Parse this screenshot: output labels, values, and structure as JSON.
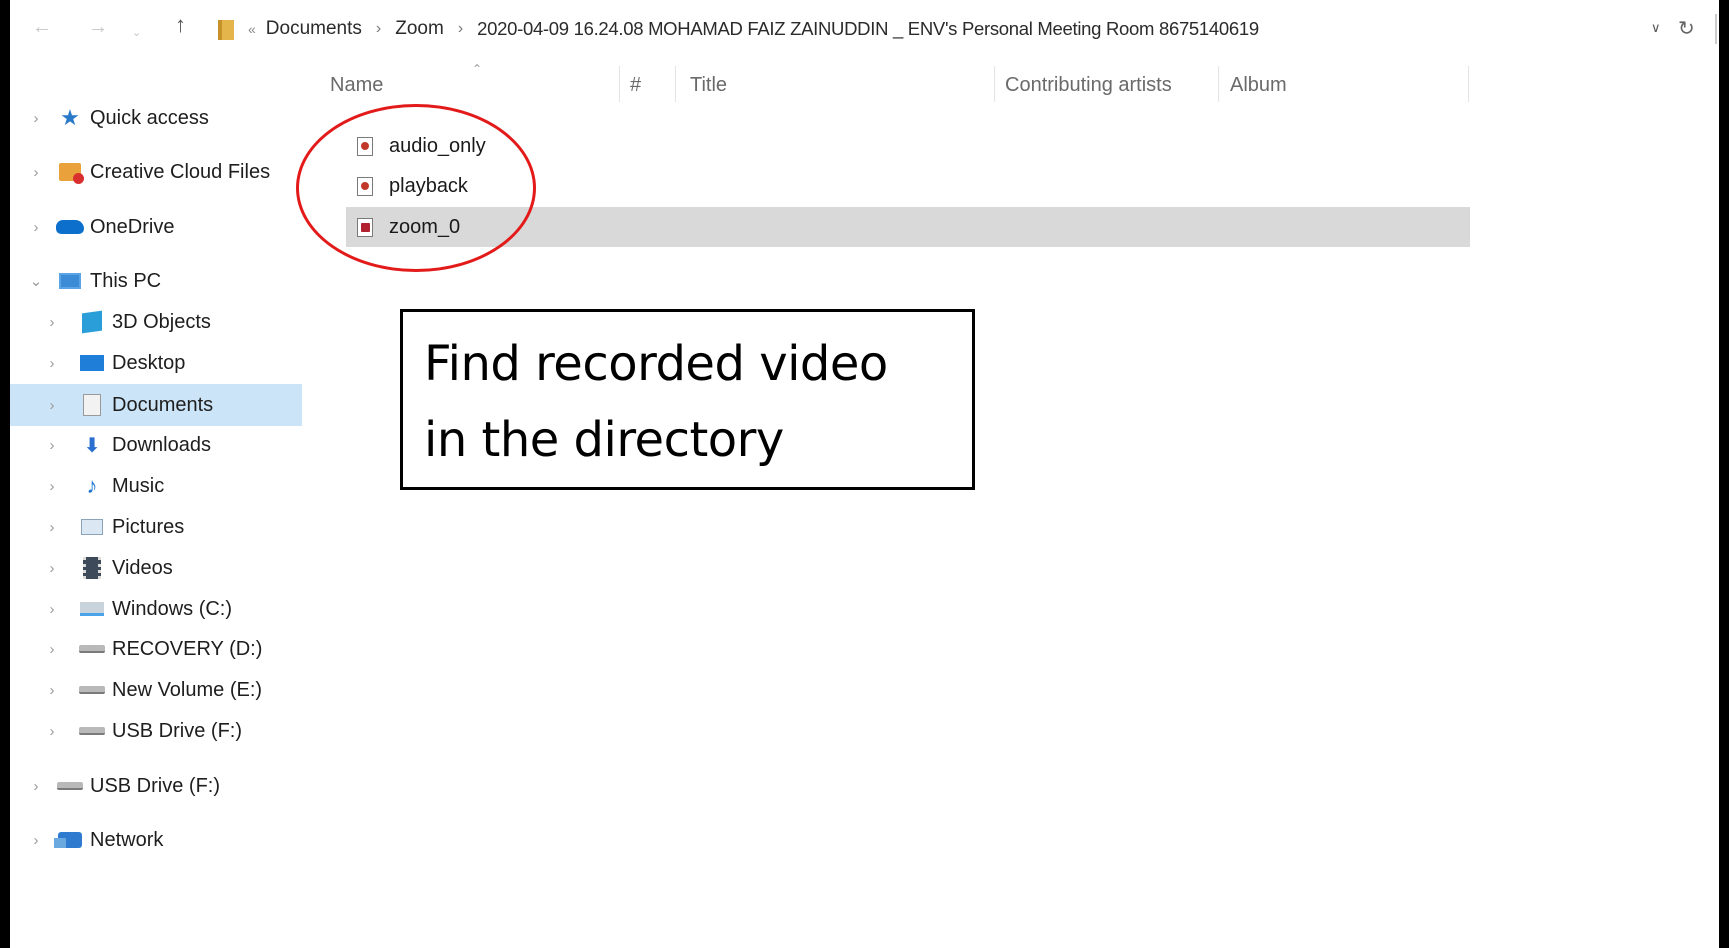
{
  "address_bar": {
    "back_icon": "arrow-left-icon",
    "forward_icon": "arrow-right-icon",
    "up_icon": "arrow-up-icon",
    "overflow": "«",
    "path": [
      "Documents",
      "Zoom",
      "2020-04-09 16.24.08 MOHAMAD FAIZ ZAINUDDIN _ ENV's Personal Meeting Room 8675140619"
    ],
    "separator": "›"
  },
  "nav_pane": {
    "items": [
      {
        "label": "Quick access",
        "icon": "star-icon",
        "level": 0,
        "expanded": false
      },
      {
        "label": "Creative Cloud Files",
        "icon": "creative-cloud-icon",
        "level": 0,
        "expanded": false
      },
      {
        "label": "OneDrive",
        "icon": "onedrive-cloud-icon",
        "level": 0,
        "expanded": false
      },
      {
        "label": "This PC",
        "icon": "this-pc-icon",
        "level": 0,
        "expanded": true
      },
      {
        "label": "3D Objects",
        "icon": "cube-icon",
        "level": 1,
        "expanded": false
      },
      {
        "label": "Desktop",
        "icon": "desktop-icon",
        "level": 1,
        "expanded": false
      },
      {
        "label": "Documents",
        "icon": "documents-icon",
        "level": 1,
        "expanded": false,
        "selected": true
      },
      {
        "label": "Downloads",
        "icon": "download-arrow-icon",
        "level": 1,
        "expanded": false
      },
      {
        "label": "Music",
        "icon": "music-note-icon",
        "level": 1,
        "expanded": false
      },
      {
        "label": "Pictures",
        "icon": "pictures-icon",
        "level": 1,
        "expanded": false
      },
      {
        "label": "Videos",
        "icon": "film-icon",
        "level": 1,
        "expanded": false
      },
      {
        "label": "Windows (C:)",
        "icon": "windows-drive-icon",
        "level": 1,
        "expanded": false
      },
      {
        "label": "RECOVERY (D:)",
        "icon": "drive-icon",
        "level": 1,
        "expanded": false
      },
      {
        "label": "New Volume (E:)",
        "icon": "drive-icon",
        "level": 1,
        "expanded": false
      },
      {
        "label": "USB Drive (F:)",
        "icon": "drive-icon",
        "level": 1,
        "expanded": false
      },
      {
        "label": "USB Drive (F:)",
        "icon": "drive-icon",
        "level": 0,
        "expanded": false
      },
      {
        "label": "Network",
        "icon": "network-icon",
        "level": 0,
        "expanded": false
      }
    ]
  },
  "file_list": {
    "columns": [
      "Name",
      "#",
      "Title",
      "Contributing artists",
      "Album"
    ],
    "sorted_by": "Name",
    "files": [
      {
        "name": "audio_only",
        "icon": "audio-file-icon",
        "selected": false
      },
      {
        "name": "playback",
        "icon": "audio-file-icon",
        "selected": false
      },
      {
        "name": "zoom_0",
        "icon": "video-file-icon",
        "selected": true
      }
    ]
  },
  "annotation": {
    "callout_lines": [
      "Find recorded video",
      "in the directory"
    ],
    "highlight_color": "#e31a1a"
  }
}
